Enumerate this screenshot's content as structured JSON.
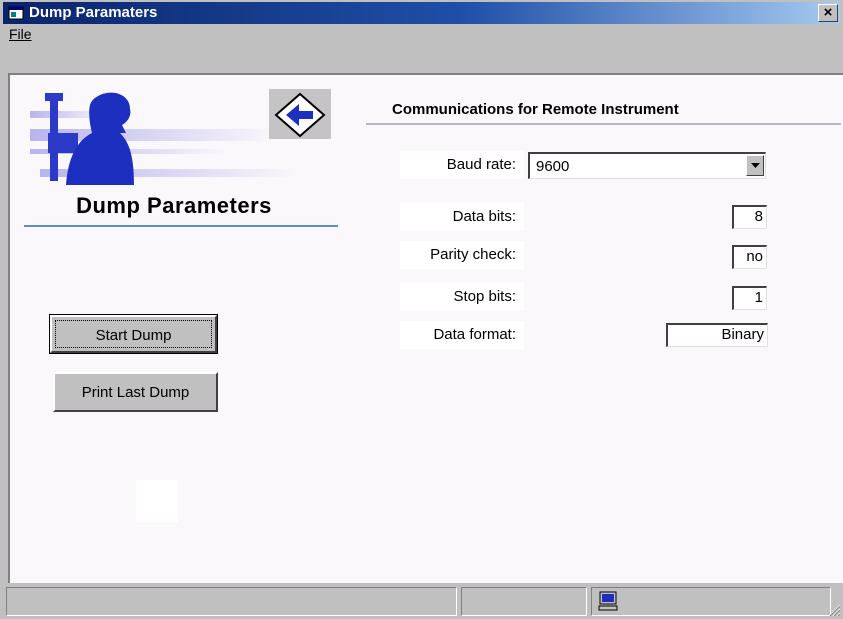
{
  "window": {
    "title": "Dump Paramaters",
    "close_glyph": "×"
  },
  "menu": {
    "file_label": "File"
  },
  "left": {
    "title": "Dump Parameters",
    "start_button": "Start Dump",
    "print_button": "Print Last Dump"
  },
  "right": {
    "header": "Communications for Remote Instrument",
    "baud_label": "Baud rate:",
    "baud_value": "9600",
    "data_bits_label": "Data bits:",
    "data_bits_value": "8",
    "parity_label": "Parity check:",
    "parity_value": "no",
    "stop_bits_label": "Stop bits:",
    "stop_bits_value": "1",
    "format_label": "Data format:",
    "format_value": "Binary"
  },
  "icons": {
    "app": "window-app-icon",
    "back": "back-arrow-icon",
    "dropdown": "chevron-down-icon",
    "status": "computer-icon",
    "grip": "resize-grip-icon"
  },
  "colors": {
    "titlebar_start": "#0a246a",
    "titlebar_end": "#a6caf0",
    "client_bg": "#fbf8fb",
    "accent_blue": "#1d2fbf"
  }
}
